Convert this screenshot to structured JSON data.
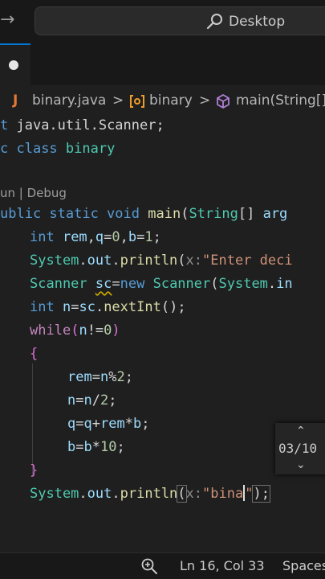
{
  "titlebar": {
    "back_icon": "arrow-right-icon",
    "search_label": "Desktop",
    "search_icon": "search-icon"
  },
  "tabbar": {
    "modified_indicator": "●"
  },
  "breadcrumb": {
    "file": "binary.java",
    "sep": ">",
    "class": "binary",
    "method": "main(String[]"
  },
  "code": {
    "l1_kw": "t ",
    "l1_rest": "java.util.Scanner;",
    "l2_kw": "c ",
    "l2_kw2": "class ",
    "l2_name": "binary",
    "codelens": "un | Debug",
    "l4_kw": "ublic static void ",
    "l4_fn": "main",
    "l4_p": "(",
    "l4_ty": "String",
    "l4_arr": "[] ",
    "l4_arg": "arg",
    "l5_kw": "int ",
    "l5_a": "rem",
    "l5_b": ",",
    "l5_c": "q",
    "l5_d": "=",
    "l5_e": "0",
    "l5_f": ",",
    "l5_g": "b",
    "l5_h": "=",
    "l5_i": "1",
    "l5_j": ";",
    "l6_ty": "System",
    "l6_d1": ".",
    "l6_out": "out",
    "l6_d2": ".",
    "l6_fn": "println",
    "l6_p": "(",
    "l6_hint": "x:",
    "l6_str": "\"Enter deci",
    "l7_ty": "Scanner",
    "l7_sp": " ",
    "l7_var": "sc",
    "l7_eq": "=",
    "l7_new": "new ",
    "l7_ty2": "Scanner",
    "l7_p": "(",
    "l7_ty3": "System",
    "l7_d": ".",
    "l7_in": "in",
    "l8_kw": "int ",
    "l8_n": "n",
    "l8_eq": "=",
    "l8_sc": "sc",
    "l8_d": ".",
    "l8_fn": "nextInt",
    "l8_end": "();",
    "l9_kw": "while",
    "l9_p1": "(",
    "l9_n": "n",
    "l9_op": "!=",
    "l9_num": "0",
    "l9_p2": ")",
    "l10": "{",
    "l11_a": "rem",
    "l11_b": "=",
    "l11_c": "n",
    "l11_d": "%",
    "l11_e": "2",
    "l11_f": ";",
    "l12_a": "n",
    "l12_b": "=",
    "l12_c": "n",
    "l12_d": "/",
    "l12_e": "2",
    "l12_f": ";",
    "l13_a": "q",
    "l13_b": "=",
    "l13_c": "q",
    "l13_d": "+",
    "l13_e": "rem",
    "l13_f": "*",
    "l13_g": "b",
    "l13_h": ";",
    "l14_a": "b",
    "l14_b": "=",
    "l14_c": "b",
    "l14_d": "*",
    "l14_e": "10",
    "l14_f": ";",
    "l15": "}",
    "l16_ty": "System",
    "l16_d1": ".",
    "l16_out": "out",
    "l16_d2": ".",
    "l16_fn": "println",
    "l16_p": "(",
    "l16_hint": "x:",
    "l16_str": "\"bina",
    "l16_q": "\"",
    "l16_end": ");"
  },
  "find": {
    "up": "⌃",
    "count": "03/10",
    "down": "⌄"
  },
  "statusbar": {
    "zoom_icon": "zoom-in-icon",
    "position": "Ln 16, Col 33",
    "indent": "Spaces"
  }
}
